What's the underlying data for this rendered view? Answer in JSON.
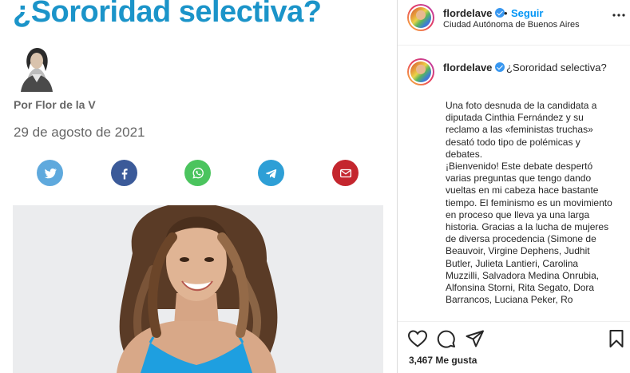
{
  "article": {
    "title": "¿Sororidad selectiva?",
    "byline": "Por Flor de la V",
    "date": "29 de agosto de 2021",
    "share_icons": [
      "twitter-icon",
      "facebook-icon",
      "whatsapp-icon",
      "telegram-icon",
      "mail-icon"
    ]
  },
  "post": {
    "username": "flordelave",
    "separator": "•",
    "follow_label": "Seguir",
    "location": "Ciudad Autónoma de Buenos Aires",
    "caption_title": "¿Sororidad selectiva?",
    "caption_lines": [
      "Una foto desnuda de la candidata a diputada Cinthia Fernández y su reclamo a las «feministas truchas» desató todo tipo de polémicas y debates.",
      "¡Bienvenido! Este debate despertó varias preguntas que tengo dando vueltas en mi cabeza hace bastante tiempo. El feminismo es un movimiento en proceso que lleva ya una larga historia. Gracias a la lucha de mujeres de diversa procedencia (Simone de Beauvoir, Virgine Dephens, Judhit Butler, Julieta Lantieri, Carolina Muzzilli, Salvadora Medina Onrubia, Alfonsina Storni, Rita Segato, Dora Barrancos, Luciana Peker, Ro"
    ],
    "likes": "3,467 Me gusta"
  },
  "colors": {
    "title_blue": "#1b94c9",
    "follow_blue": "#0095f6",
    "twitter": "#5fa9dd",
    "facebook": "#3b5a99",
    "whatsapp": "#4bc45e",
    "telegram": "#2e9fd6",
    "mail": "#c4262e",
    "dress_blue": "#1e9fe0"
  }
}
